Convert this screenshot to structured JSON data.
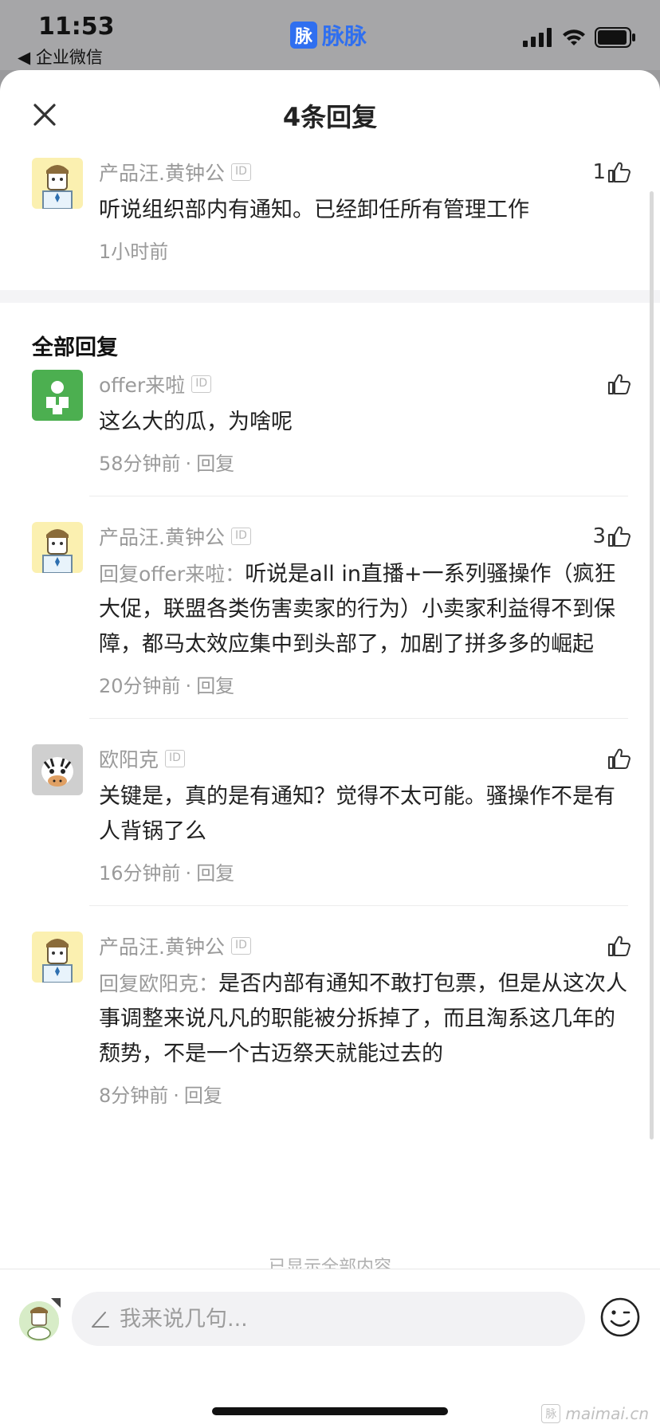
{
  "status_bar": {
    "time": "11:53",
    "back_app": "◀ 企业微信",
    "app_logo": "脉",
    "app_name": "脉脉",
    "icons": [
      "signal-icon",
      "wifi-icon",
      "battery-icon"
    ]
  },
  "sheet": {
    "title": "4条回复",
    "main_comment": {
      "author": "产品汪.黄钟公",
      "id_badge": "ID",
      "text": "听说组织部内有通知。已经卸任所有管理工作",
      "time": "1小时前",
      "likes": "1"
    },
    "section_title": "全部回复",
    "replies": [
      {
        "author": "offer来啦",
        "id_badge": "ID",
        "reply_prefix": "",
        "text": "这么大的瓜，为啥呢",
        "time": "58分钟前",
        "reply_label": "回复",
        "likes": ""
      },
      {
        "author": "产品汪.黄钟公",
        "id_badge": "ID",
        "reply_prefix": "回复offer来啦：",
        "text": "听说是all in直播+一系列骚操作（疯狂大促，联盟各类伤害卖家的行为）小卖家利益得不到保障，都马太效应集中到头部了，加剧了拼多多的崛起",
        "time": "20分钟前",
        "reply_label": "回复",
        "likes": "3"
      },
      {
        "author": "欧阳克",
        "id_badge": "ID",
        "reply_prefix": "",
        "text": "关键是，真的是有通知？觉得不太可能。骚操作不是有人背锅了么",
        "time": "16分钟前",
        "reply_label": "回复",
        "likes": ""
      },
      {
        "author": "产品汪.黄钟公",
        "id_badge": "ID",
        "reply_prefix": "回复欧阳克：",
        "text": "是否内部有通知不敢打包票，但是从这次人事调整来说凡凡的职能被分拆掉了，而且淘系这几年的颓势，不是一个古迈祭天就能过去的",
        "time": "8分钟前",
        "reply_label": "回复",
        "likes": ""
      }
    ],
    "peek_text": "已显示全部内容"
  },
  "bottom_bar": {
    "input_placeholder": "我来说几句...",
    "watermark_text": "maimai.cn",
    "watermark_logo": "脉"
  },
  "colors": {
    "accent": "#2f6ff0",
    "muted_text": "#9a9a9a",
    "avatar_yellow": "#fbf0b0",
    "avatar_green": "#4caf50"
  }
}
